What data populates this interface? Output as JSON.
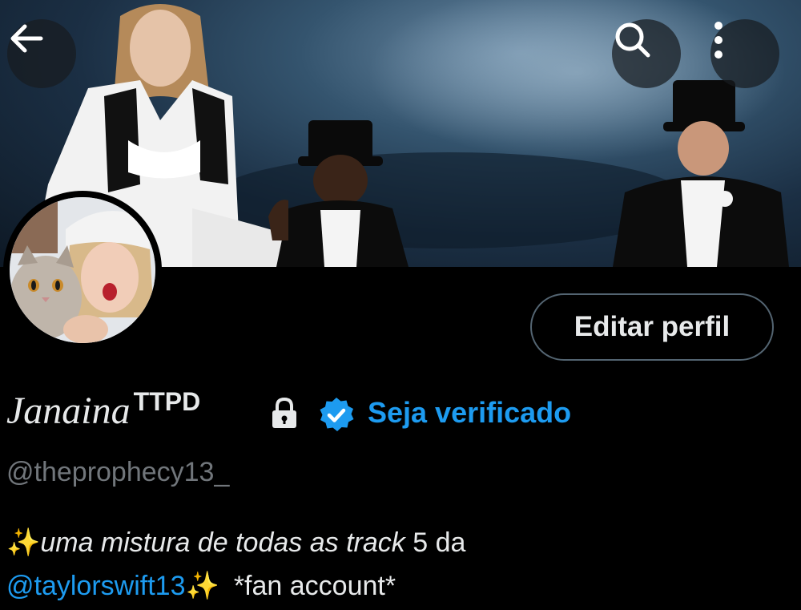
{
  "header": {
    "back_icon": "arrow-left-icon",
    "search_icon": "search-icon",
    "more_icon": "more-vertical-icon",
    "banner_description": "concert photo banner"
  },
  "profile": {
    "display_name": "Janaina",
    "display_name_suffix": "TTPD",
    "handle": "@theprophecy13_",
    "edit_button_label": "Editar perfil",
    "verify_label": "Seja verificado",
    "bio": {
      "sparkle_1": "✨",
      "line1_italic": "uma mistura de todas as track",
      "line1_tail": " 5 da",
      "mention": "@taylorswift13",
      "sparkle_2": "✨",
      "tail": "*fan account*"
    }
  },
  "colors": {
    "background": "#000000",
    "accent": "#1d9bf0",
    "text": "#e7e9ea",
    "secondary_text": "#71767b",
    "button_border": "#536471"
  }
}
